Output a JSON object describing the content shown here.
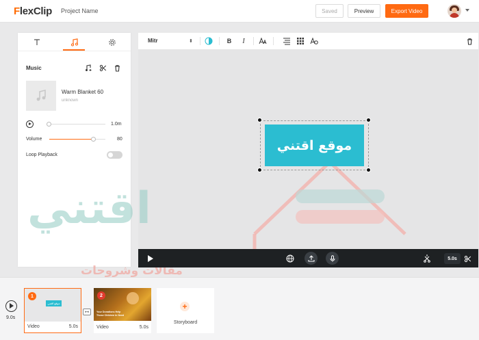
{
  "header": {
    "logo_prefix": "F",
    "logo_rest": "lexClip",
    "project_name": "Project Name",
    "saved_label": "Saved",
    "preview_label": "Preview",
    "export_label": "Export Video"
  },
  "left_panel": {
    "tabs": [
      "text-icon",
      "music-icon",
      "settings-icon"
    ],
    "active_tab": "music",
    "section_title": "Music",
    "track": {
      "name": "Warm Blanket 60",
      "artist": "unknown",
      "duration": "1.0m"
    },
    "volume_label": "Volume",
    "volume_value": "80",
    "loop_label": "Loop Playback"
  },
  "toolbar": {
    "font_name": "Mitr",
    "bold_label": "B",
    "italic_label": "I"
  },
  "canvas": {
    "caption_text": "موقع اقتني",
    "caption_bg": "#2bbdd1"
  },
  "player": {
    "duration": "5.0s"
  },
  "watermark": {
    "text_main": "اقتني",
    "text_sub": "مقالات وشروحات"
  },
  "timeline": {
    "total": "9.0s",
    "clips": [
      {
        "number": "1",
        "label": "Video",
        "duration": "5.0s",
        "caption": "موقع اقتني"
      },
      {
        "number": "2",
        "label": "Video",
        "duration": "5.0s",
        "overlay_line1": "Your Donations Help",
        "overlay_line2": "Those Children in Need"
      }
    ],
    "storyboard_label": "Storyboard"
  }
}
